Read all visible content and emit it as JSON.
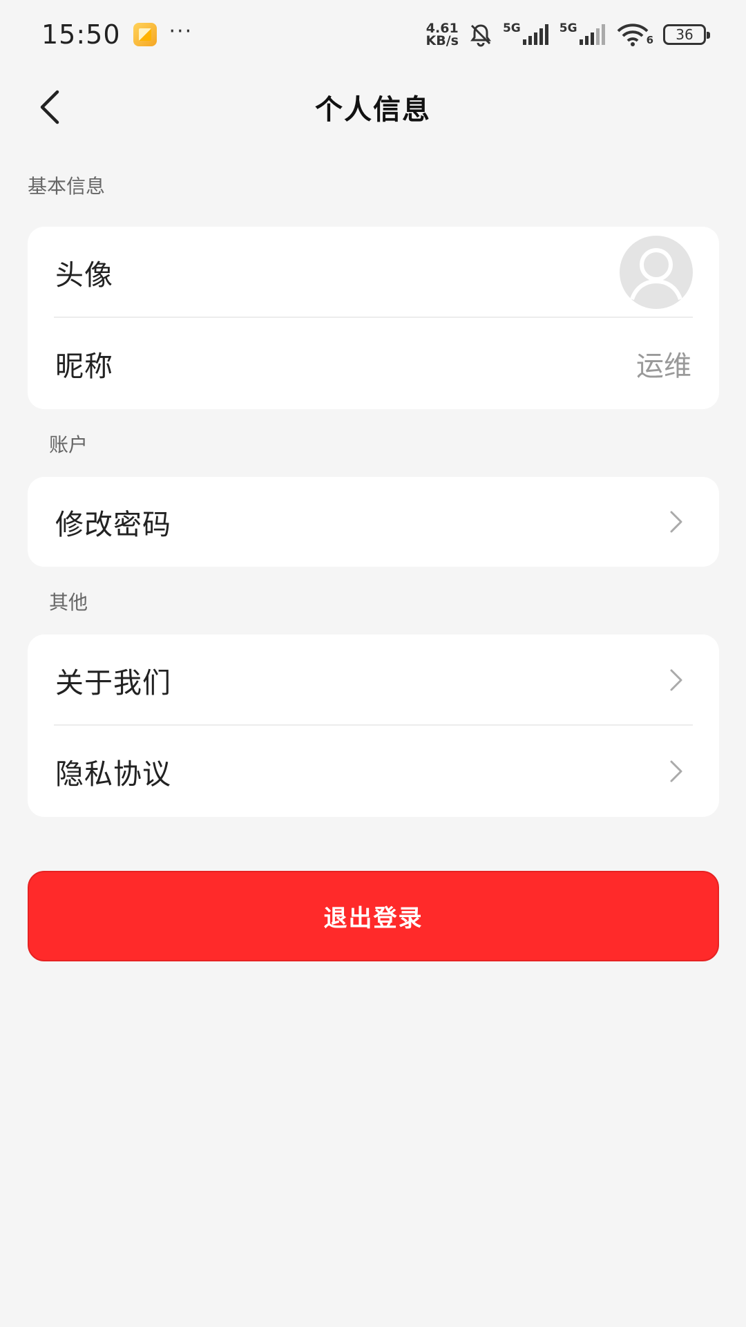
{
  "status_bar": {
    "time": "15:50",
    "more": "···",
    "speed_value": "4.61",
    "speed_unit": "KB/s",
    "net1": "5G",
    "net2": "5G",
    "wifi_badge": "6",
    "battery": "36",
    "icons": [
      "app-notification-icon",
      "bell-muted-icon",
      "signal-icon",
      "wifi-icon",
      "battery-icon"
    ]
  },
  "nav": {
    "title": "个人信息",
    "back_icon": "chevron-left-icon"
  },
  "sections": {
    "basic": {
      "label": "基本信息",
      "rows": [
        {
          "label": "头像",
          "icon": "avatar-placeholder-icon"
        },
        {
          "label": "昵称",
          "value": "运维"
        }
      ]
    },
    "account": {
      "label": "账户",
      "rows": [
        {
          "label": "修改密码",
          "icon": "chevron-right-icon"
        }
      ]
    },
    "other": {
      "label": "其他",
      "rows": [
        {
          "label": "关于我们",
          "icon": "chevron-right-icon"
        },
        {
          "label": "隐私协议",
          "icon": "chevron-right-icon"
        }
      ]
    }
  },
  "logout": {
    "label": "退出登录"
  },
  "colors": {
    "background": "#f5f5f5",
    "card": "#ffffff",
    "danger": "#ff2a2a",
    "muted_text": "#999999"
  }
}
